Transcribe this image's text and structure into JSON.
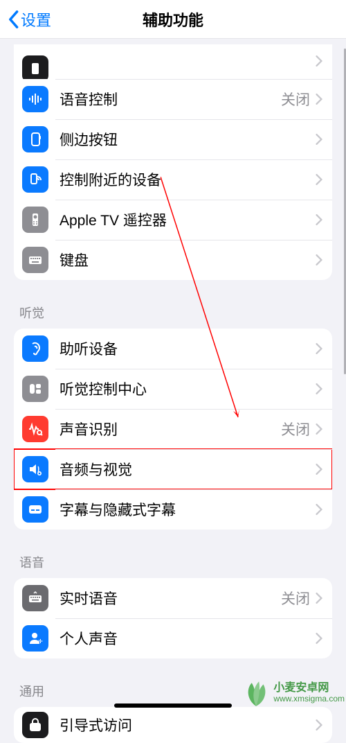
{
  "nav": {
    "back": "设置",
    "title": "辅助功能"
  },
  "status": {
    "off": "关闭"
  },
  "group_touch": [
    {
      "icon": "voice-control-icon",
      "label": "语音控制",
      "detail": "关闭",
      "bg": "blue"
    },
    {
      "icon": "side-button-icon",
      "label": "侧边按钮",
      "bg": "blue"
    },
    {
      "icon": "nearby-devices-icon",
      "label": "控制附近的设备",
      "bg": "blue"
    },
    {
      "icon": "apple-tv-remote-icon",
      "label": "Apple TV 遥控器",
      "bg": "gray"
    },
    {
      "icon": "keyboard-icon",
      "label": "键盘",
      "bg": "gray"
    }
  ],
  "section_hearing": "听觉",
  "group_hearing": [
    {
      "icon": "hearing-device-icon",
      "label": "助听设备",
      "bg": "blue"
    },
    {
      "icon": "hearing-cc-icon",
      "label": "听觉控制中心",
      "bg": "gray"
    },
    {
      "icon": "sound-recognition-icon",
      "label": "声音识别",
      "detail": "关闭",
      "bg": "red"
    },
    {
      "icon": "audio-visual-icon",
      "label": "音频与视觉",
      "bg": "blue",
      "highlight": true
    },
    {
      "icon": "subtitles-icon",
      "label": "字幕与隐藏式字幕",
      "bg": "blue"
    }
  ],
  "section_speech": "语音",
  "group_speech": [
    {
      "icon": "live-speech-icon",
      "label": "实时语音",
      "detail": "关闭",
      "bg": "darkgray"
    },
    {
      "icon": "personal-voice-icon",
      "label": "个人声音",
      "bg": "blue"
    }
  ],
  "section_general": "通用",
  "group_general": [
    {
      "icon": "guided-access-icon",
      "label": "引导式访问",
      "bg": "black"
    }
  ],
  "watermark": {
    "cn": "小麦安卓网",
    "url": "www.xmsigma.com"
  }
}
